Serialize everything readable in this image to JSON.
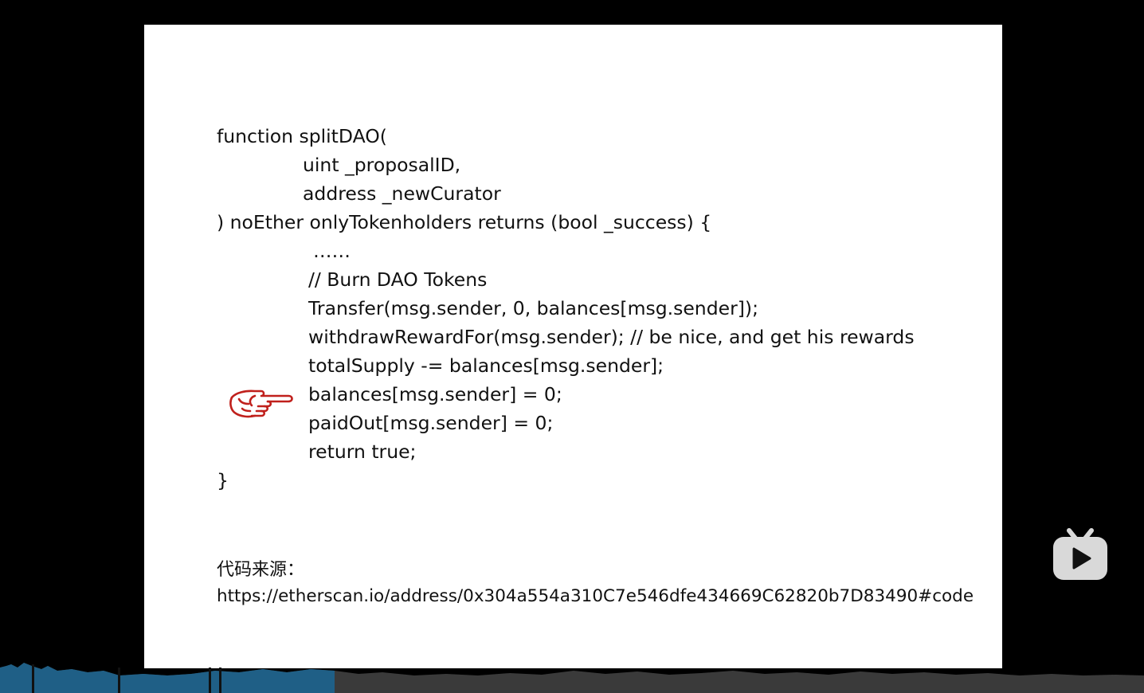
{
  "slide": {
    "code_lines": [
      "function splitDAO(",
      "uint _proposalID,",
      "address _newCurator",
      ") noEther onlyTokenholders returns (bool _success) {",
      "……",
      "// Burn DAO Tokens",
      "Transfer(msg.sender, 0, balances[msg.sender]);",
      "withdrawRewardFor(msg.sender); // be nice, and get his rewards",
      "totalSupply -= balances[msg.sender];",
      "balances[msg.sender] = 0;",
      "paidOut[msg.sender] = 0;",
      "return true;",
      "}"
    ],
    "source_label": "代码来源：",
    "source_url": "https://etherscan.io/address/0x304a554a310C7e546dfe434669C62820b7D83490#code",
    "pointer_icon": "pointing-hand-icon"
  },
  "player": {
    "logo_icon": "bilibili-tv-icon",
    "progress": 0.29
  },
  "colors": {
    "pointer": "#c0201c",
    "progress_played": "#1f5f86",
    "progress_waveform": "#3a3a3a",
    "logo": "#d9d9d9"
  }
}
